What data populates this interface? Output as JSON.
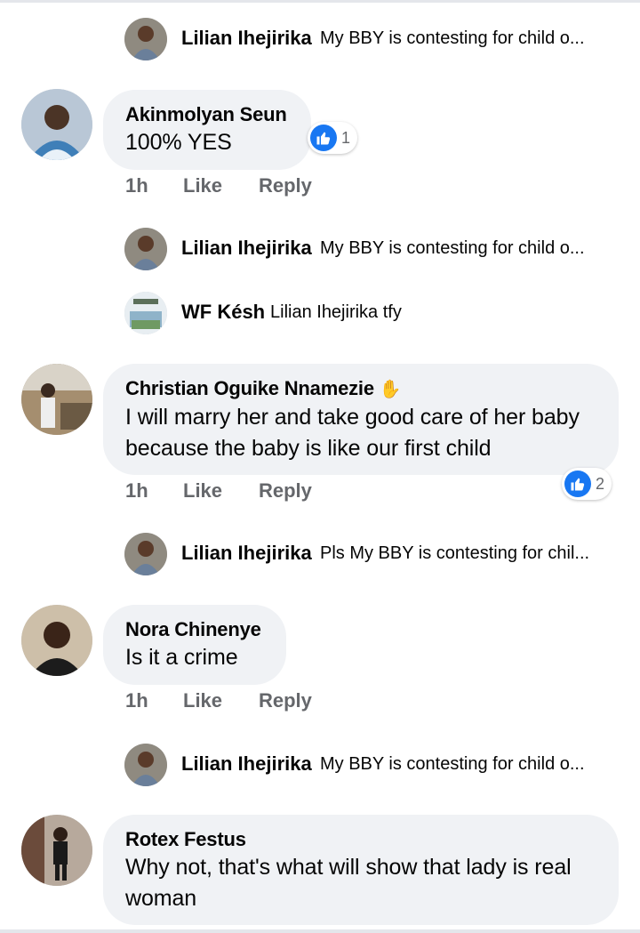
{
  "comments": [
    {
      "author": "Akinmolyan Seun",
      "text": "100% YES",
      "time": "1h",
      "like": "Like",
      "reply": "Reply",
      "reactions": "1"
    },
    {
      "author": "Christian Oguike Nnamezie",
      "badge_icon": "waving-hand-icon",
      "text": "I will marry her and take good care of her baby because the baby is like our first child",
      "time": "1h",
      "like": "Like",
      "reply": "Reply",
      "reactions": "2"
    },
    {
      "author": "Nora Chinenye",
      "text": "Is it a crime",
      "time": "1h",
      "like": "Like",
      "reply": "Reply"
    },
    {
      "author": "Rotex Festus",
      "text": "Why not, that's what will show that lady is real woman"
    }
  ],
  "replies": [
    {
      "author": "Lilian Ihejirika",
      "text": "My BBY is contesting for child o..."
    },
    {
      "author": "Lilian Ihejirika",
      "text": "My BBY is contesting for child o..."
    },
    {
      "author": "WF Késh",
      "text": "Lilian Ihejirika tfy"
    },
    {
      "author": "Lilian Ihejirika",
      "text": "Pls My BBY is contesting for chil..."
    },
    {
      "author": "Lilian Ihejirika",
      "text": "My BBY is contesting for child o..."
    }
  ],
  "colors": {
    "bubble": "#f0f2f5",
    "like_blue": "#1877f2",
    "meta_gray": "#65676b"
  }
}
